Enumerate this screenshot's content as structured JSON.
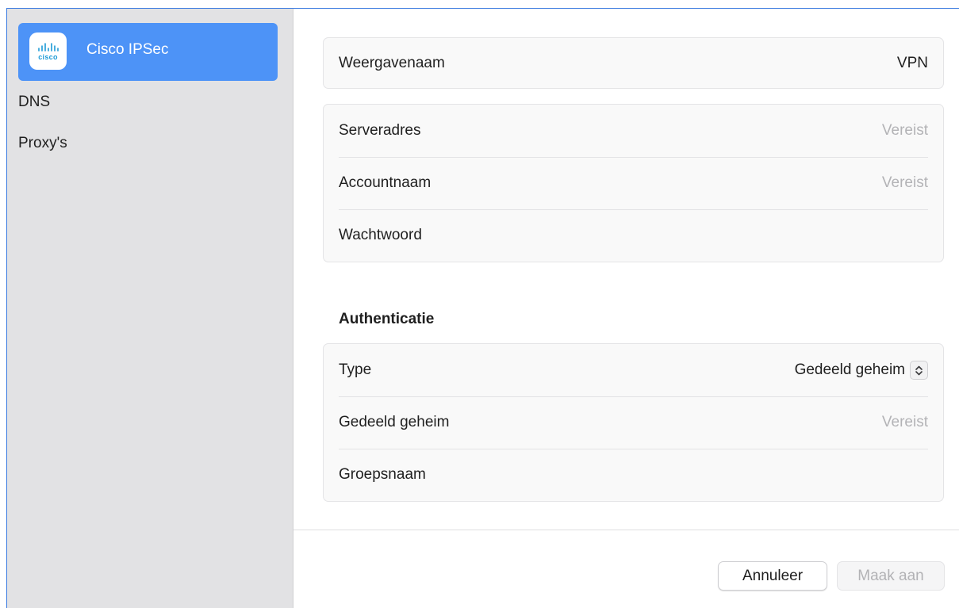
{
  "sidebar": {
    "selected": {
      "label": "Cisco IPSec",
      "icon": "cisco-logo",
      "logo_text": "cisco"
    },
    "items": [
      {
        "label": "DNS"
      },
      {
        "label": "Proxy's"
      }
    ]
  },
  "general": {
    "display_name": {
      "label": "Weergavenaam",
      "value": "VPN"
    }
  },
  "connection": {
    "server": {
      "label": "Serveradres",
      "placeholder": "Vereist"
    },
    "account": {
      "label": "Accountnaam",
      "placeholder": "Vereist"
    },
    "password": {
      "label": "Wachtwoord",
      "value": ""
    }
  },
  "authentication": {
    "title": "Authenticatie",
    "type": {
      "label": "Type",
      "value": "Gedeeld geheim",
      "icon": "chevron-up-down-icon"
    },
    "shared_secret": {
      "label": "Gedeeld geheim",
      "placeholder": "Vereist"
    },
    "group_name": {
      "label": "Groepsnaam",
      "value": ""
    }
  },
  "footer": {
    "cancel_label": "Annuleer",
    "create_label": "Maak aan"
  },
  "colors": {
    "accent": "#4d93f7",
    "sidebar_bg": "#e2e2e4",
    "placeholder": "#b3b3b6",
    "cisco_blue": "#1b9ad6"
  }
}
